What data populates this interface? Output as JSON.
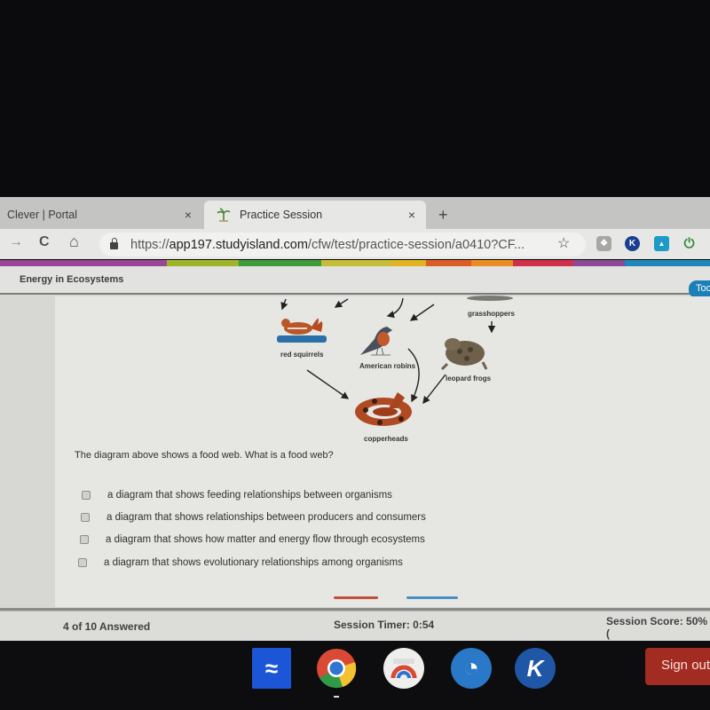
{
  "browser": {
    "tabs": [
      {
        "title": "Clever | Portal",
        "active": false,
        "close_glyph": "×"
      },
      {
        "title": "Practice Session",
        "active": true,
        "close_glyph": "×",
        "favicon": "palm-tree-icon"
      }
    ],
    "new_tab_glyph": "+",
    "nav": {
      "forward_glyph": "→",
      "reload_glyph": "C",
      "home_glyph": "⌂"
    },
    "url": {
      "scheme": "https://",
      "host": "app197.studyisland.com",
      "path": "/cfw/test/practice-session/a0410?CF..."
    },
    "star_glyph": "☆",
    "extensions": [
      {
        "name": "extension-puzzle-icon",
        "glyph": "❖",
        "color": "#a7a8a5"
      },
      {
        "name": "kami-extension-icon",
        "glyph": "K",
        "color": "#1a3f8f"
      },
      {
        "name": "screencastify-extension-icon",
        "glyph": "▲",
        "color": "#1b9bc6"
      },
      {
        "name": "power-extension-icon",
        "glyph": "⏻",
        "color": "#2f8a3a"
      }
    ]
  },
  "colorbar": [
    "#9b4596",
    "#9eb52a",
    "#3c9a3c",
    "#c5bc37",
    "#e2b321",
    "#dd5d27",
    "#e98e22",
    "#d0304b",
    "#8a4a94",
    "#1f87b9"
  ],
  "page": {
    "title": "Energy in Ecosystems",
    "tools_label": "Too"
  },
  "diagram": {
    "organisms": [
      {
        "label": "grasshoppers"
      },
      {
        "label": "red squirrels"
      },
      {
        "label": "American robins"
      },
      {
        "label": "leopard frogs"
      },
      {
        "label": "copperheads"
      }
    ]
  },
  "question": {
    "text": "The diagram above shows a food web. What is a food web?",
    "answers": [
      "a diagram that shows feeding relationships between organisms",
      "a diagram that shows relationships between producers and consumers",
      "a diagram that shows how matter and energy flow through ecosystems",
      "a diagram that shows evolutionary relationships among organisms"
    ]
  },
  "status": {
    "answered": "4 of 10 Answered",
    "timer": "Session Timer: 0:54",
    "score": "Session Score: 50% ("
  },
  "shelf": {
    "apps": [
      {
        "name": "launcher-app-icon",
        "glyph": "≈"
      },
      {
        "name": "chrome-app-icon"
      },
      {
        "name": "web-store-app-icon"
      },
      {
        "name": "ce-app-icon",
        "glyph": "◔"
      },
      {
        "name": "kahoot-app-icon",
        "glyph": "K"
      }
    ],
    "sign_out": "Sign out"
  }
}
